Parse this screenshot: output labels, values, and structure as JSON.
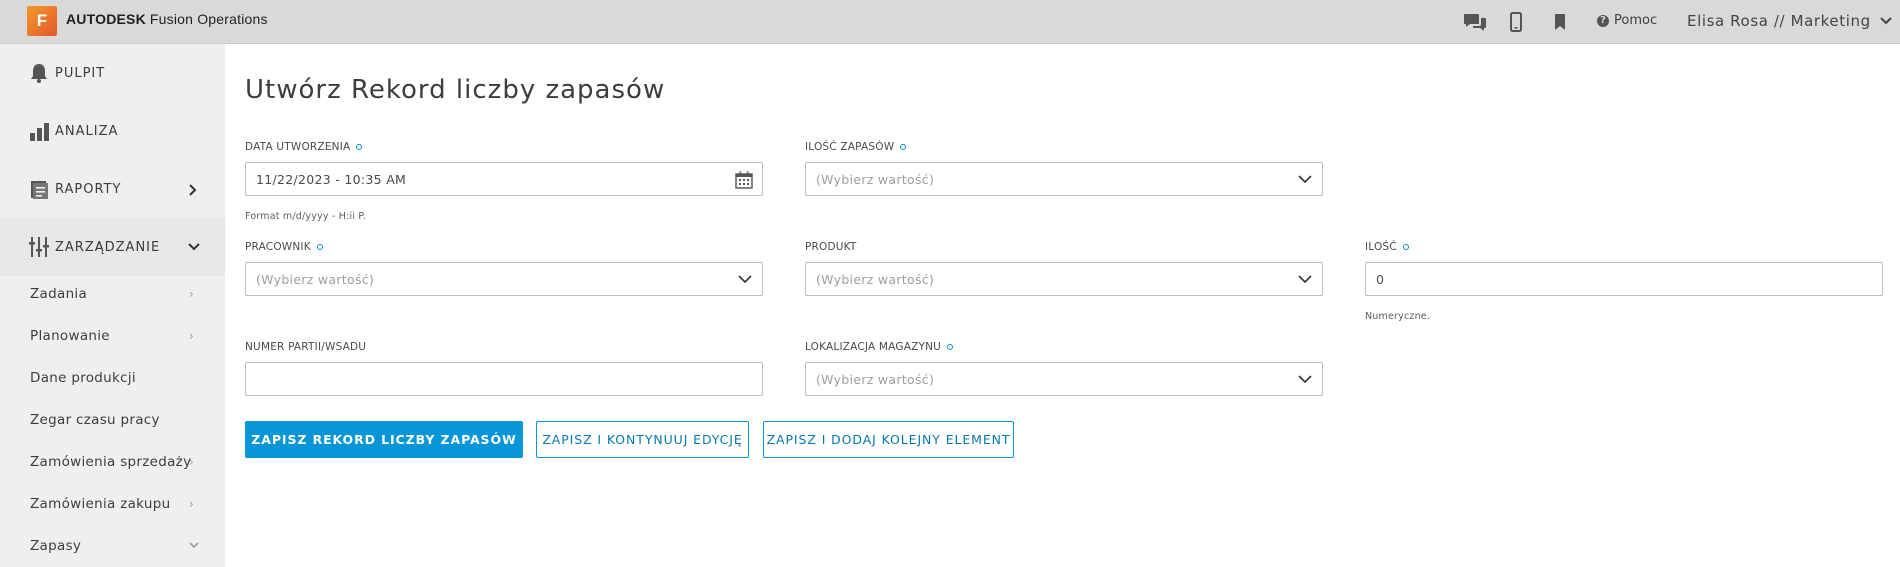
{
  "app": {
    "logo_letter": "F",
    "brand": "AUTODESK",
    "product": "Fusion Operations",
    "help_label": "Pomoc",
    "user_label": "Elisa Rosa // Marketing"
  },
  "sidebar": {
    "main": [
      {
        "label": "PULPIT",
        "icon": "bell-icon"
      },
      {
        "label": "ANALIZA",
        "icon": "bar-chart-icon"
      },
      {
        "label": "RAPORTY",
        "icon": "report-icon"
      },
      {
        "label": "ZARZĄDZANIE",
        "icon": "sliders-icon"
      }
    ],
    "sub": [
      {
        "label": "Zadania"
      },
      {
        "label": "Planowanie"
      },
      {
        "label": "Dane produkcji"
      },
      {
        "label": "Zegar czasu pracy"
      },
      {
        "label": "Zamówienia sprzedaży"
      },
      {
        "label": "Zamówienia zakupu"
      },
      {
        "label": "Zapasy"
      }
    ]
  },
  "form": {
    "title": "Utwórz Rekord liczby zapasów",
    "created_date": {
      "label": "DATA UTWORZENIA",
      "value": "11/22/2023 - 10:35 AM",
      "hint": "Format m/d/yyyy - H:ii P."
    },
    "stock_count": {
      "label": "ILOŚĆ ZAPASÓW",
      "placeholder": "(Wybierz wartość)"
    },
    "employee": {
      "label": "PRACOWNIK",
      "placeholder": "(Wybierz wartość)"
    },
    "product": {
      "label": "PRODUKT",
      "placeholder": "(Wybierz wartość)"
    },
    "quantity": {
      "label": "ILOŚĆ",
      "value": "0",
      "hint": "Numeryczne."
    },
    "batch_number": {
      "label": "NUMER PARTII/WSADU",
      "value": ""
    },
    "warehouse_location": {
      "label": "LOKALIZACJA MAGAZYNU",
      "placeholder": "(Wybierz wartość)"
    },
    "buttons": {
      "save": "ZAPISZ REKORD LICZBY ZAPASÓW",
      "save_continue": "ZAPISZ I KONTYNUUJ EDYCJĘ",
      "save_add": "ZAPISZ I DODAJ KOLEJNY ELEMENT"
    }
  },
  "colors": {
    "accent": "#0696d7",
    "topbar": "#d9d9d9",
    "sidebar": "#efefef"
  }
}
